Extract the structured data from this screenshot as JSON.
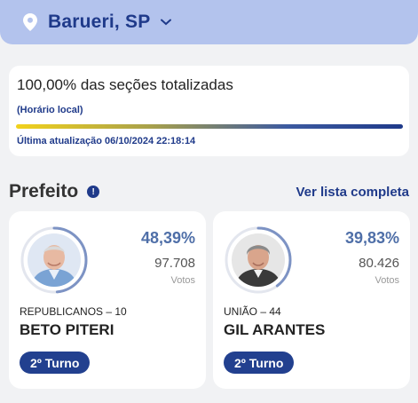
{
  "header": {
    "city": "Barueri, SP",
    "location_icon": "map-pin-icon",
    "dropdown_icon": "chevron-down-icon"
  },
  "status": {
    "title": "100,00% das seções totalizadas",
    "local_time_note": "(Horário local)",
    "progress": 1.0,
    "last_update": "Última atualização 06/10/2024 22:18:14"
  },
  "section": {
    "title": "Prefeito",
    "info_icon": "info-icon",
    "view_all": "Ver lista completa"
  },
  "candidates": [
    {
      "percent": "48,39%",
      "percent_value": 48.39,
      "votes": "97.708",
      "votes_label": "Votos",
      "party": "REPUBLICANOS – 10",
      "name": "BETO PITERI",
      "status": "2º Turno"
    },
    {
      "percent": "39,83%",
      "percent_value": 39.83,
      "votes": "80.426",
      "votes_label": "Votos",
      "party": "UNIÃO – 44",
      "name": "GIL ARANTES",
      "status": "2º Turno"
    }
  ],
  "colors": {
    "accent": "#1f3a8a",
    "header_bg": "#b3c3ed",
    "badge": "#22408f",
    "percent": "#4f6fa8"
  }
}
